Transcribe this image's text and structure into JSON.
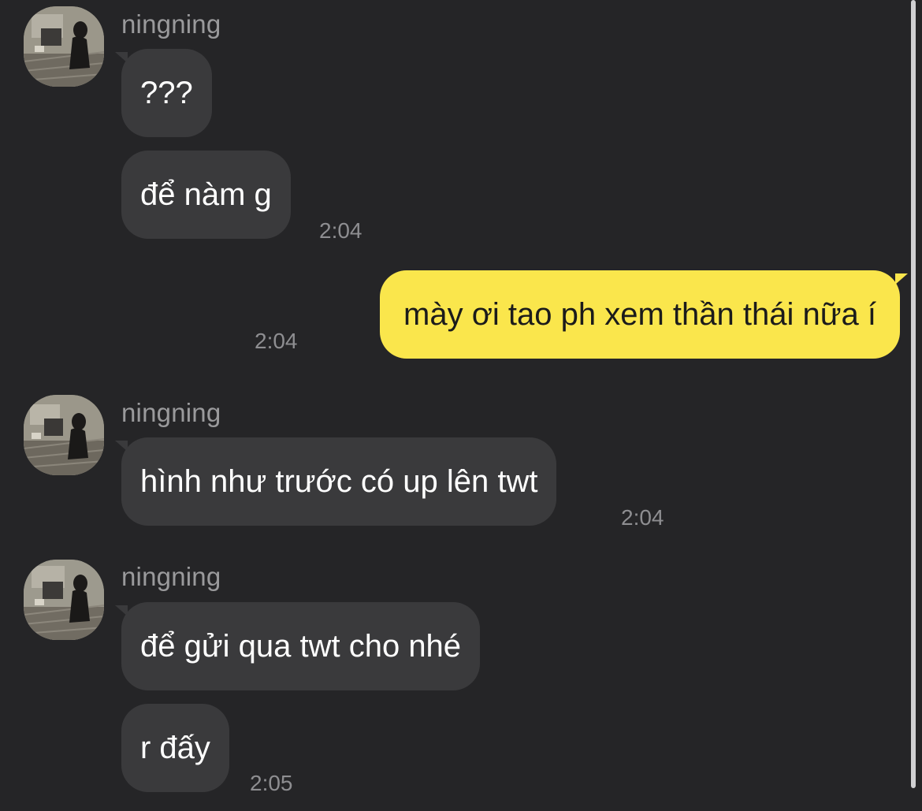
{
  "conversation": {
    "group1": {
      "sender": "ningning",
      "msg1": "???",
      "msg2": "để nàm g",
      "time": "2:04"
    },
    "outgoing": {
      "text": "mày ơi tao ph xem thần thái nữa í",
      "time": "2:04"
    },
    "group2": {
      "sender": "ningning",
      "msg1": "hình như trước có up lên twt",
      "time": "2:04"
    },
    "group3": {
      "sender": "ningning",
      "msg1": "để gửi qua twt cho nhé",
      "msg2": "r đấy",
      "time": "2:05"
    }
  },
  "icons": {
    "avatar": "profile-photo-icon"
  },
  "colors": {
    "background": "#252527",
    "incoming_bubble": "#3a3a3c",
    "outgoing_bubble": "#fae64c",
    "meta_text": "#8e8e91"
  }
}
